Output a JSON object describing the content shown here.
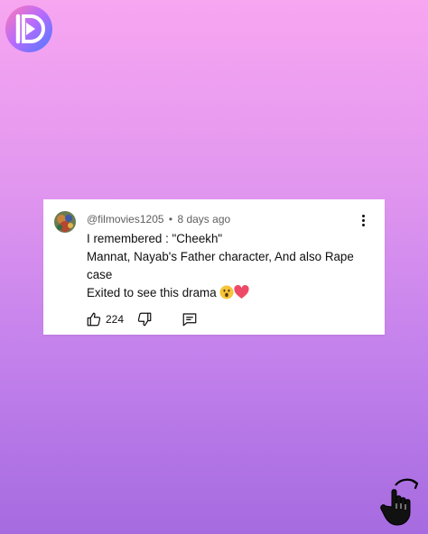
{
  "brand": {
    "logo_icon": "play-d-logo-icon",
    "colors": {
      "ring": "#ffffff",
      "inner_bg": "#ffffff"
    }
  },
  "comment": {
    "avatar_icon": "user-avatar",
    "author": "@filmovies1205",
    "separator": "•",
    "timestamp": "8 days ago",
    "lines": [
      "I remembered : \"Cheekh\"",
      "Mannat, Nayab's Father character, And also Rape case",
      "Exited to see this drama"
    ],
    "emojis": [
      "astonished-face-emoji",
      "red-heart-emoji"
    ],
    "likes": "224",
    "icons": {
      "more": "more-vert-icon",
      "like": "thumb-up-icon",
      "dislike": "thumb-down-icon",
      "reply": "comment-reply-icon"
    }
  },
  "overlay": {
    "swipe_icon": "swipe-hand-icon"
  },
  "colors": {
    "bg_top": "#f7a6f0",
    "bg_bottom": "#a66be0",
    "card": "#ffffff",
    "text": "#0f0f0f",
    "meta": "#606060"
  }
}
